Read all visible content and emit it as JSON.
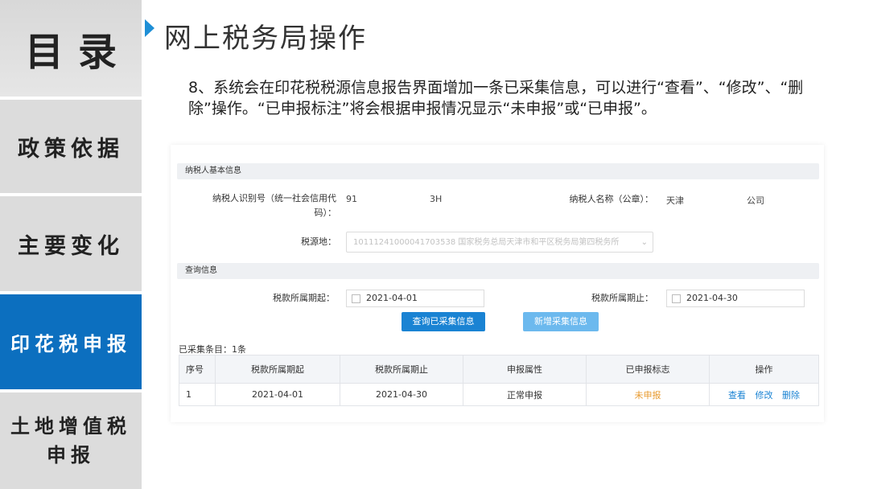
{
  "nav": {
    "toc": "目录",
    "items": [
      "政策依据",
      "主要变化",
      "印花税申报",
      "土地增值税申报"
    ]
  },
  "header": {
    "title": "网上税务局操作",
    "description": "8、系统会在印花税税源信息报告界面增加一条已采集信息，可以进行“查看”、“修改”、“删除”操作。“已申报标注”将会根据申报情况显示“未申报”或“已申报”。"
  },
  "taxpayer": {
    "section_title": "纳税人基本信息",
    "id_label": "纳税人识别号（统一社会信用代码）：",
    "id_value_prefix": "91",
    "id_value_suffix": "3H",
    "name_label": "纳税人名称（公章）：",
    "name_value_prefix": "天津",
    "name_value_suffix": "公司",
    "source_label": "税源地：",
    "source_value": "10111241000041703538 国家税务总局天津市和平区税务局第四税务所"
  },
  "query": {
    "section_title": "查询信息",
    "start_label": "税款所属期起：",
    "start_value": "2021-04-01",
    "end_label": "税款所属期止：",
    "end_value": "2021-04-30",
    "query_button": "查询已采集信息",
    "add_button": "新增采集信息"
  },
  "collected": {
    "count_text": "已采集条目：1条",
    "columns": [
      "序号",
      "税款所属期起",
      "税款所属期止",
      "申报属性",
      "已申报标志",
      "操作"
    ],
    "rows": [
      {
        "no": "1",
        "start": "2021-04-01",
        "end": "2021-04-30",
        "attr": "正常申报",
        "flag": "未申报"
      }
    ],
    "actions": [
      "查看",
      "修改",
      "删除"
    ]
  },
  "colors": {
    "nav_active": "#0c6fbf",
    "accent": "#1a83d3",
    "status_pending": "#e89a2e"
  }
}
